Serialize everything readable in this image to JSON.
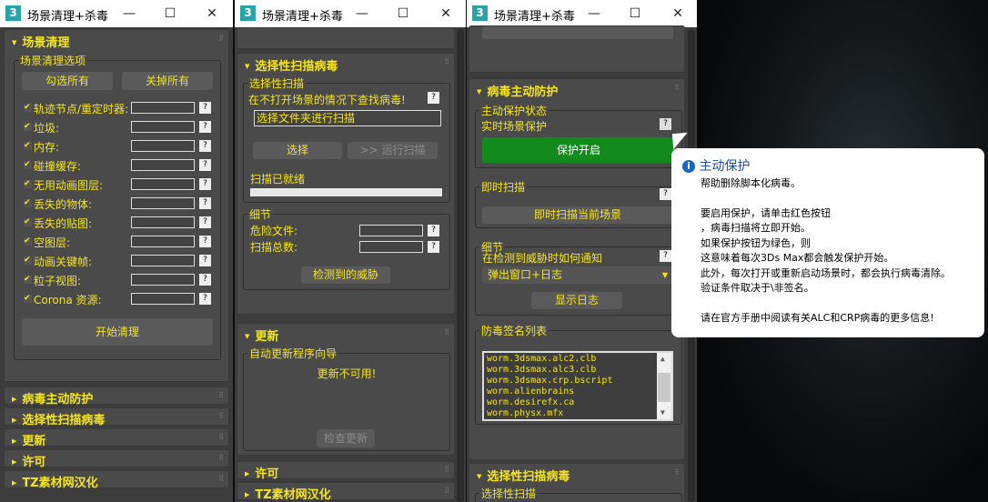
{
  "window_title": "场景清理+杀毒",
  "app_icon": "3",
  "title_controls": {
    "minimize": "—",
    "maximize": "☐",
    "close": "✕"
  },
  "left": {
    "rollout_title": "场景清理",
    "group_label": "场景清理选项",
    "check_all": "勾选所有",
    "uncheck_all": "关掉所有",
    "items": [
      "轨迹节点/重定时器:",
      "垃圾:",
      "内存:",
      "碰撞缓存:",
      "无用动画图层:",
      "丢失的物体:",
      "丢失的贴图:",
      "空图层:",
      "动画关键帧:",
      "粒子视图:",
      "Corona 资源:"
    ],
    "help": "?",
    "start": "开始清理",
    "collapsed": [
      "病毒主动防护",
      "选择性扫描病毒",
      "更新",
      "许可",
      "TZ素材网汉化"
    ]
  },
  "middle": {
    "rollout_title": "选择性扫描病毒",
    "group_label": "选择性扫描",
    "hint": "在不打开场景的情况下查找病毒!",
    "folder_input": "选择文件夹进行扫描",
    "select": "选择",
    "run": ">> 运行扫描",
    "status": "扫描已就绪",
    "progress": 0,
    "details_label": "细节",
    "danger_files": "危险文件:",
    "total_scanned": "扫描总数:",
    "threats": "检测到的威胁",
    "update_title": "更新",
    "update_group": "自动更新程序向导",
    "update_status": "更新不可用!",
    "check_update": "检查更新",
    "collapsed": [
      "许可",
      "TZ素材网汉化"
    ]
  },
  "right": {
    "rollout_title": "病毒主动防护",
    "status_group": "主动保护状态",
    "realtime": "实时场景保护",
    "protect_on": "保护开启",
    "instant_label": "即时扫描",
    "instant_btn": "即时扫描当前场景",
    "details_label": "细节",
    "notify": "在检测到威胁时如何通知",
    "notify_value": "弹出窗口+日志",
    "show_log": "显示日志",
    "sig_label": "防毒签名列表",
    "signatures": [
      "worm.3dsmax.alc2.clb",
      "worm.3dsmax.alc3.clb",
      "worm.3dsmax.crp.bscript",
      "worm.alienbrains",
      "worm.desirefx.ca",
      "worm.physx.mfx"
    ],
    "next_rollout": "选择性扫描病毒",
    "next_group": "选择性扫描",
    "green": "#138a1c"
  },
  "tooltip": {
    "title": "主动保护",
    "lines": [
      "帮助删除脚本化病毒。",
      "",
      "要启用保护，请单击红色按钮",
      "，病毒扫描将立即开始。",
      "如果保护按钮为绿色，则",
      "这意味着每次3Ds Max都会触发保护开始。",
      "此外，每次打开或重新启动场景时，都会执行病毒清除。",
      "验证条件取决于\\非签名。",
      "",
      "请在官方手册中阅读有关ALC和CRP病毒的更多信息!"
    ]
  }
}
